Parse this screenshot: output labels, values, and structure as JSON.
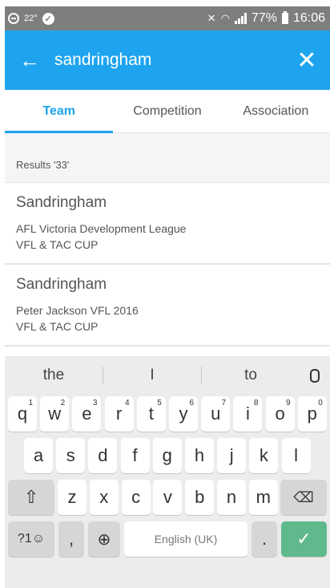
{
  "status_bar": {
    "temperature": "22°",
    "battery": "77%",
    "time": "16:06"
  },
  "search": {
    "query": "sandringham"
  },
  "tabs": [
    {
      "label": "Team",
      "active": true
    },
    {
      "label": "Competition",
      "active": false
    },
    {
      "label": "Association",
      "active": false
    }
  ],
  "results": {
    "count_label": "Results '33'",
    "items": [
      {
        "name": "Sandringham",
        "line1": "AFL Victoria Development League",
        "line2": "VFL & TAC CUP"
      },
      {
        "name": "Sandringham",
        "line1": "Peter Jackson VFL 2016",
        "line2": "VFL & TAC CUP"
      }
    ]
  },
  "keyboard": {
    "suggestions": [
      "the",
      "I",
      "to"
    ],
    "row1": [
      {
        "k": "q",
        "h": "1"
      },
      {
        "k": "w",
        "h": "2"
      },
      {
        "k": "e",
        "h": "3"
      },
      {
        "k": "r",
        "h": "4"
      },
      {
        "k": "t",
        "h": "5"
      },
      {
        "k": "y",
        "h": "6"
      },
      {
        "k": "u",
        "h": "7"
      },
      {
        "k": "i",
        "h": "8"
      },
      {
        "k": "o",
        "h": "9"
      },
      {
        "k": "p",
        "h": "0"
      }
    ],
    "row2": [
      "a",
      "s",
      "d",
      "f",
      "g",
      "h",
      "j",
      "k",
      "l"
    ],
    "row3": [
      "z",
      "x",
      "c",
      "v",
      "b",
      "n",
      "m"
    ],
    "symbols_label": "?1☺",
    "comma": ",",
    "space_label": "English (UK)",
    "period": "."
  },
  "colors": {
    "accent": "#1ea4ef",
    "enter": "#5fb98c"
  }
}
